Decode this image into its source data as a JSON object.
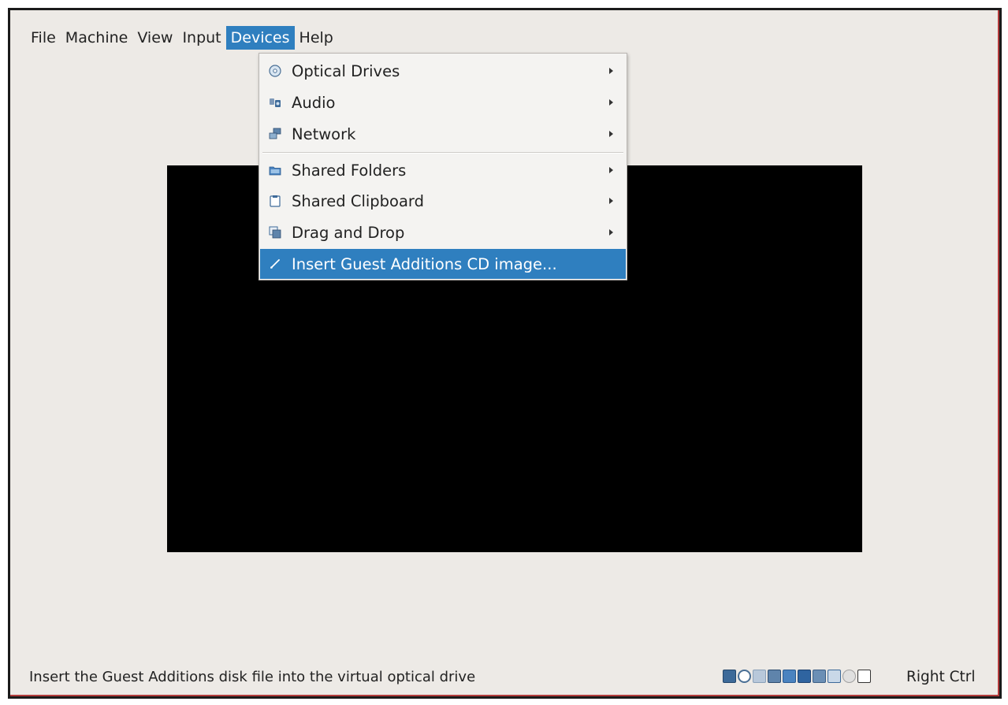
{
  "menubar": {
    "items": [
      {
        "label": "File"
      },
      {
        "label": "Machine"
      },
      {
        "label": "View"
      },
      {
        "label": "Input"
      },
      {
        "label": "Devices"
      },
      {
        "label": "Help"
      }
    ],
    "active_item": "Devices"
  },
  "devices_menu": {
    "items": [
      {
        "label": "Optical Drives",
        "icon": "optical-disc-icon",
        "submenu": true
      },
      {
        "label": "Audio",
        "icon": "audio-icon",
        "submenu": true
      },
      {
        "label": "Network",
        "icon": "network-icon",
        "submenu": true
      },
      {
        "label": "Shared Folders",
        "icon": "shared-folder-icon",
        "submenu": true
      },
      {
        "label": "Shared Clipboard",
        "icon": "clipboard-icon",
        "submenu": true
      },
      {
        "label": "Drag and Drop",
        "icon": "drag-drop-icon",
        "submenu": true
      },
      {
        "label": "Insert Guest Additions CD image...",
        "icon": "insert-cd-icon",
        "submenu": false,
        "highlighted": true
      }
    ]
  },
  "statusbar": {
    "message": "Insert the Guest Additions disk file into the virtual optical drive",
    "host_key": "Right Ctrl",
    "indicator_icons": [
      "hard-disk-icon",
      "optical-drive-icon",
      "audio-indicator-icon",
      "network-indicator-icon",
      "shared-folder-indicator-icon",
      "display-indicator-icon",
      "video-capture-icon",
      "usb-icon",
      "cpu-icon",
      "mouse-integration-icon"
    ]
  },
  "colors": {
    "accent": "#2f7fbf",
    "window_background": "#edeae6",
    "guest_screen": "#000000"
  }
}
